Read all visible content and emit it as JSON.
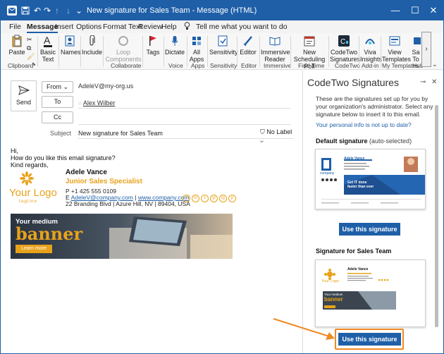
{
  "window": {
    "title": "New signature for Sales Team  -  Message (HTML)",
    "controls": {
      "minimize": "—",
      "restore": "☐",
      "close": "✕"
    }
  },
  "quick_access": [
    "save-icon",
    "undo-icon",
    "redo-icon",
    "up-icon",
    "down-icon",
    "more-icon"
  ],
  "menu": {
    "items": [
      "File",
      "Message",
      "Insert",
      "Options",
      "Format Text",
      "Review",
      "Help"
    ],
    "active": "Message",
    "tell_me": "Tell me what you want to do"
  },
  "ribbon": {
    "buttons": {
      "paste": "Paste",
      "basic_text": "Basic Text",
      "names": "Names",
      "include": "Include",
      "loop": "Loop Components",
      "tags": "Tags",
      "dictate": "Dictate",
      "all_apps": "All Apps",
      "sensitivity": "Sensitivity",
      "editor": "Editor",
      "immersive": "Immersive Reader",
      "scheduling": "New Scheduling Poll",
      "codetwo": "CodeTwo Signatures",
      "viva": "Viva Insights",
      "view_templates": "View Templates",
      "sa": "Sa To"
    },
    "groups": {
      "clipboard": "Clipboard",
      "collaborate": "Collaborate",
      "voice": "Voice",
      "apps": "Apps",
      "sensitivity": "Sensitivity",
      "editor": "Editor",
      "immersive": "Immersive",
      "find_time": "Find Time",
      "codetwo": "CodeTwo",
      "addin": "Add-in",
      "my_templates": "My Templates",
      "hub": "Hub"
    }
  },
  "compose": {
    "send": "Send",
    "from_label": "From",
    "from_value": "AdeleV@my-org.us",
    "to_label": "To",
    "to_value": "Alex Wilber",
    "cc_label": "Cc",
    "subject_label": "Subject",
    "subject_value": "New signature for Sales Team",
    "no_label": "No Label",
    "body": {
      "line1": "Hi,",
      "line2": "How do you like this email signature?",
      "line3": "Kind regards,"
    },
    "signature": {
      "logo": "Your Logo",
      "tagline": "tagline",
      "name": "Adele Vance",
      "role": "Junior Sales Specialist",
      "phone": "P +1 425 555 0109",
      "email_prefix": "E",
      "email": "AdeleV@company.com",
      "site_sep": " | ",
      "website": "www.company.com",
      "address": "22 Branding Blvd | Azure Hill, NV | 89404, USA",
      "social": [
        "f",
        "in",
        "x",
        "yt",
        "ig",
        "p"
      ]
    },
    "banner": {
      "line1": "Your medium",
      "line2": "banner",
      "cta": "Learn more"
    }
  },
  "pane": {
    "title": "CodeTwo Signatures",
    "description": "These are the signatures set up for you by your organization's administrator. Select any signature below to insert it to this email.",
    "link": "Your personal info is not up to date?",
    "default_heading": "Default signature",
    "default_suffix": "(auto-selected)",
    "sales_heading": "Signature for Sales Team",
    "use_button": "Use this signature",
    "thumb1": {
      "name": "Adele Vance",
      "company": "company",
      "banner_title": "Get IT done",
      "banner_sub": "faster than ever"
    },
    "thumb2": {
      "name": "Adele Vance",
      "logo": "Your Logo",
      "banner_line1": "Your medium",
      "banner_line2": "banner"
    }
  }
}
